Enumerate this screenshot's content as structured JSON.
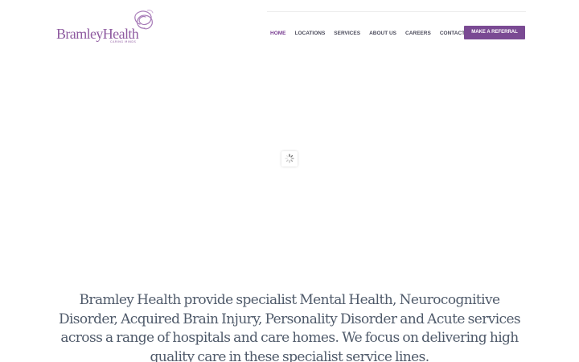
{
  "brand": {
    "name": "BramleyHealth",
    "tagline": "CARING MINDS",
    "color": "#8e5aa0"
  },
  "nav": {
    "items": [
      {
        "label": "HOME",
        "active": true
      },
      {
        "label": "LOCATIONS",
        "active": false
      },
      {
        "label": "SERVICES",
        "active": false
      },
      {
        "label": "ABOUT US",
        "active": false
      },
      {
        "label": "CAREERS",
        "active": false
      },
      {
        "label": "CONTACT",
        "active": false
      }
    ],
    "active_color": "#7a3f92",
    "text_color": "#4a4a5a"
  },
  "cta": {
    "label": "MAKE A REFERRAL",
    "color": "#7a4a93"
  },
  "loader": {
    "icon": "spinner-icon"
  },
  "intro": {
    "text": "Bramley Health provide specialist Mental Health, Neurocognitive Disorder, Acquired Brain Injury, Personality Disorder and Acute services across a range of hospitals and care homes. We focus on delivering high quality care in these specialist service lines."
  }
}
